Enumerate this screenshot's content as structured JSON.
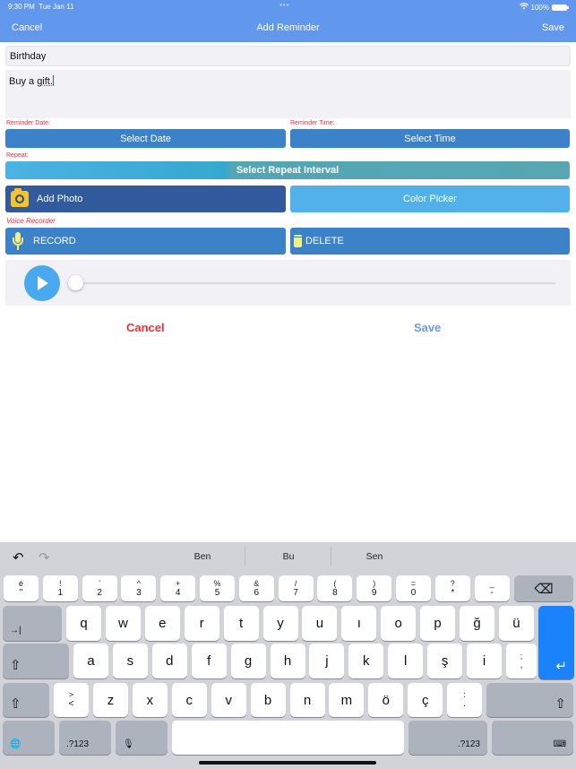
{
  "status_bar": {
    "time": "9:30 PM",
    "date": "Tue Jan 11",
    "dots": "•••",
    "battery": "100%"
  },
  "nav": {
    "cancel": "Cancel",
    "title": "Add Reminder",
    "save": "Save"
  },
  "form": {
    "title_value": "Birthday",
    "notes_prefix": "Buy a ",
    "notes_misspelled": "gift.",
    "reminder_date_label": "Reminder Date:",
    "reminder_time_label": "Reminder Time:",
    "select_date": "Select Date",
    "select_time": "Select Time",
    "repeat_label": "Repeat:",
    "select_repeat": "Select Repeat Interval",
    "add_photo": "Add Photo",
    "color_picker": "Color Picker",
    "voice_recorder_label": "Voice Recorder",
    "record": "RECORD",
    "delete": "DELETE",
    "playback_progress": 0
  },
  "actions": {
    "cancel": "Cancel",
    "save": "Save"
  },
  "colors": {
    "accent": "#6297ee",
    "label_red": "#e8333a",
    "button_blue": "#3b82c8",
    "photo_button": "#315b9c",
    "color_picker": "#51b1e8",
    "return_key": "#1a82fb"
  },
  "keyboard": {
    "undo": "↶",
    "redo": "↷",
    "suggestions": [
      "Ben",
      "Bu",
      "Sen"
    ],
    "number_row": [
      {
        "top": "é",
        "bot": "\""
      },
      {
        "top": "!",
        "bot": "1"
      },
      {
        "top": "'",
        "bot": "2"
      },
      {
        "top": "^",
        "bot": "3"
      },
      {
        "top": "+",
        "bot": "4"
      },
      {
        "top": "%",
        "bot": "5"
      },
      {
        "top": "&",
        "bot": "6"
      },
      {
        "top": "/",
        "bot": "7"
      },
      {
        "top": "(",
        "bot": "8"
      },
      {
        "top": ")",
        "bot": "9"
      },
      {
        "top": "=",
        "bot": "0"
      },
      {
        "top": "?",
        "bot": "*"
      },
      {
        "top": "_",
        "bot": "-"
      }
    ],
    "row1": [
      "q",
      "w",
      "e",
      "r",
      "t",
      "y",
      "u",
      "ı",
      "o",
      "p",
      "ğ",
      "ü"
    ],
    "row2": [
      "a",
      "s",
      "d",
      "f",
      "g",
      "h",
      "j",
      "k",
      "l",
      "ş",
      "i"
    ],
    "row2_last": {
      "top": ";",
      "bot": ","
    },
    "row3_first": {
      "top": ">",
      "bot": "<"
    },
    "row3": [
      "z",
      "x",
      "c",
      "v",
      "b",
      "n",
      "m",
      "ö",
      "ç"
    ],
    "row3_last": {
      "top": ":",
      "bot": "."
    },
    "tab": "→|",
    "shift": "⇧",
    "return": "↵",
    "backspace": "⌫",
    "globe": "🌐",
    "numbers": ".?123",
    "mic": "🎙",
    "hide": "⌨"
  }
}
